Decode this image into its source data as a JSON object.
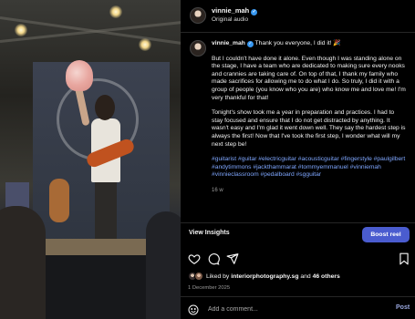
{
  "header": {
    "username": "vinnie_mah",
    "subtitle": "Original audio",
    "verified_icon": "verified-badge-icon"
  },
  "caption": {
    "username": "vinnie_mah",
    "intro": "Thank you everyone, I did it! 🎉",
    "paragraph_1": "But I couldn't have done it alone. Even though I was standing alone on the stage, I have a team who are dedicated to making sure every nooks and crannies are taking care of. On top of that, I thank my family who made sacrifices for allowing me to do what I do. So truly, I did it with a group of people (you know who you are) who know me and love me! I'm very thankful for that!",
    "paragraph_2": "Tonight's show took me a year in preparation and practices. I had to stay focused and ensure that I do not get distracted by anything. It wasn't easy and I'm glad it went down well. They say the hardest step is always the first! Now that I've took the first step, I wonder what will my next step be!",
    "hashtags": "#guitarist #guitar #electricguitar #acousticguitar #fingerstyle #paulgilbert #andytimmons #jackthammarat #tommyemmanuel #vinniemah #vinnieclassroom #pedalboard #sgguitar",
    "timestamp": "16 w"
  },
  "insights": {
    "view_label": "View Insights",
    "boost_label": "Boost reel",
    "accent_color": "#4a5ccf"
  },
  "actions": {
    "icons": [
      "heart-icon",
      "comment-icon",
      "share-icon",
      "bookmark-icon"
    ]
  },
  "likes": {
    "prefix": "Liked by ",
    "first_user": "interiorphotography.sg",
    "middle": " and ",
    "others": "46 others"
  },
  "date": "1 December 2025",
  "comment_box": {
    "placeholder": "Add a comment...",
    "post_label": "Post",
    "emoji_icon": "smiley-icon"
  },
  "colors": {
    "background": "#000000",
    "hashtag": "#7fa7ff",
    "verified": "#3797f0"
  }
}
